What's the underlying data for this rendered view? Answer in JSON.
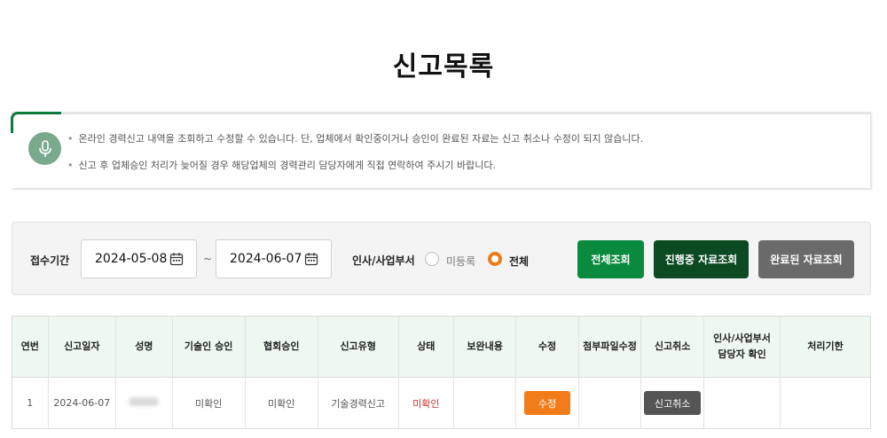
{
  "page": {
    "title": "신고목록"
  },
  "notice": {
    "items": [
      "온라인 경력신고 내역을 조회하고 수정할 수 있습니다. 단, 업체에서 확인중이거나 승인이 완료된 자료는 신고 취소나 수정이 되지 않습니다.",
      "신고 후 업체승인 처리가 늦어질 경우 해당업체의 경력관리 담당자에게 직접 연락하여 주시기 바랍니다."
    ]
  },
  "search": {
    "period_label": "접수기간",
    "start_date": "2024-05-08",
    "separator": "~",
    "end_date": "2024-06-07",
    "dept_label": "인사/사업부서",
    "radio_options": [
      {
        "label": "미등록",
        "checked": false
      },
      {
        "label": "전체",
        "checked": true
      }
    ],
    "buttons": {
      "all": "전체조회",
      "in_progress": "진행중 자료조회",
      "completed": "완료된 자료조회"
    }
  },
  "colors": {
    "accent_green": "#0b7a3a",
    "btn_all": "#0a8a3e",
    "btn_in_progress": "#0b4a22",
    "btn_completed": "#6a6a6a",
    "btn_edit": "#f27c1a",
    "btn_cancel": "#555555",
    "status_red": "#d22c2c",
    "header_bg": "#eef8f1"
  },
  "table": {
    "headers": [
      "연번",
      "신고일자",
      "성명",
      "기술인 승인",
      "협회승인",
      "신고유형",
      "상태",
      "보완내용",
      "수정",
      "첨부파일수정",
      "신고취소",
      "인사/사업부서\n담당자 확인",
      "처리기한"
    ],
    "rows": [
      {
        "no": "1",
        "date": "2024-06-07",
        "name": "",
        "tech_approval": "미확인",
        "assoc_approval": "미확인",
        "report_type": "기술경력신고",
        "status": "미확인",
        "supplement": "",
        "edit_label": "수정",
        "attach_edit": "",
        "cancel_label": "신고취소",
        "dept_check": "",
        "deadline": ""
      }
    ]
  }
}
